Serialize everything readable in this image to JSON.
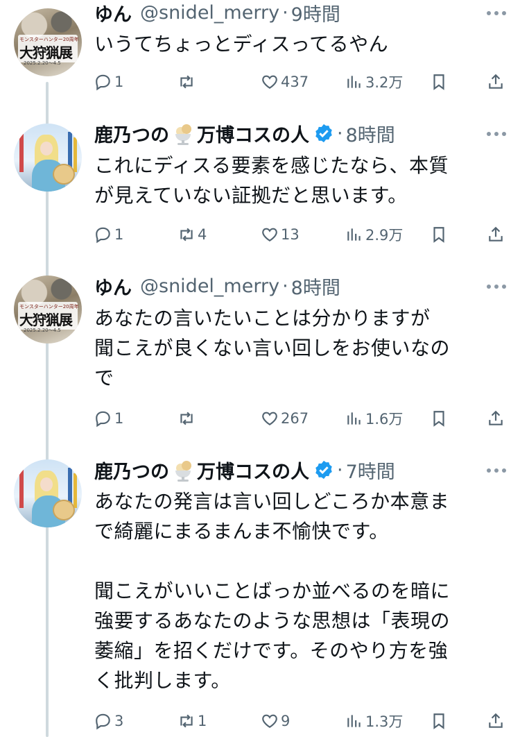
{
  "tweets": [
    {
      "avatar": "monster-hunter-avatar",
      "avatar_text": {
        "small": "モンスターハンター20周年",
        "big": "大狩猟展",
        "date": "2025.2.20〜4.5"
      },
      "name": "ゆん",
      "handle": "@snidel_merry",
      "separator": "·",
      "time": "9時間",
      "verified": false,
      "text": "いうてちょっとディスってるやん",
      "replies": "1",
      "retweets": "",
      "likes": "437",
      "views": "3.2万"
    },
    {
      "avatar": "cosplay-avatar",
      "name_prefix": "鹿乃つの",
      "emoji": "ice-cream-sundae-icon",
      "name_suffix": "万博コスの人",
      "separator": "·",
      "time": "8時間",
      "verified": true,
      "text": "これにディスる要素を感じたなら、本質\nが見えていない証拠だと思います。",
      "replies": "1",
      "retweets": "4",
      "likes": "13",
      "views": "2.9万"
    },
    {
      "avatar": "monster-hunter-avatar",
      "avatar_text": {
        "small": "モンスターハンター20周年",
        "big": "大狩猟展",
        "date": "2025.2.20〜4.5"
      },
      "name": "ゆん",
      "handle": "@snidel_merry",
      "separator": "·",
      "time": "8時間",
      "verified": false,
      "text": "あなたの言いたいことは分かりますが\n聞こえが良くない言い回しをお使いなの\nで",
      "replies": "1",
      "retweets": "",
      "likes": "267",
      "views": "1.6万"
    },
    {
      "avatar": "cosplay-avatar",
      "name_prefix": "鹿乃つの",
      "emoji": "ice-cream-sundae-icon",
      "name_suffix": "万博コスの人",
      "separator": "·",
      "time": "7時間",
      "verified": true,
      "text": "あなたの発言は言い回しどころか本意ま\nで綺麗にまるまんま不愉快です。\n\n聞こえがいいことばっか並べるのを暗に\n強要するあなたのような思想は「表現の\n萎縮」を招くだけです。そのやり方を強\nく批判します。",
      "replies": "3",
      "retweets": "1",
      "likes": "9",
      "views": "1.3万"
    }
  ],
  "colors": {
    "text": "#0f1419",
    "muted": "#536471",
    "verified": "#1d9bf0",
    "thread_line": "#cfd9de"
  }
}
